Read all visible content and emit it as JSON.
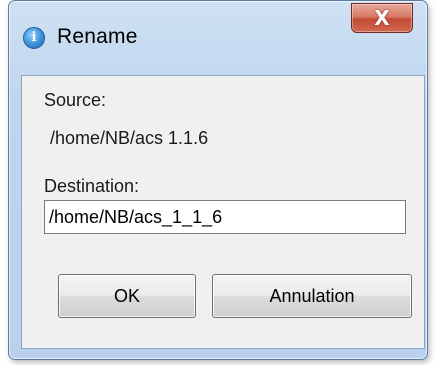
{
  "window": {
    "title": "Rename",
    "title_icon_glyph": "i",
    "close_glyph": "X"
  },
  "form": {
    "source_label": "Source:",
    "source_value": "/home/NB/acs 1.1.6",
    "destination_label": "Destination:",
    "destination_value": "/home/NB/acs_1_1_6"
  },
  "buttons": {
    "ok_label": "OK",
    "cancel_label": "Annulation"
  },
  "icons": {
    "title_icon": "info-icon",
    "close_icon": "close-icon"
  },
  "colors": {
    "frame": "#b9d1ec",
    "close_button": "#c24a33",
    "content_bg": "#f0f0f0"
  }
}
